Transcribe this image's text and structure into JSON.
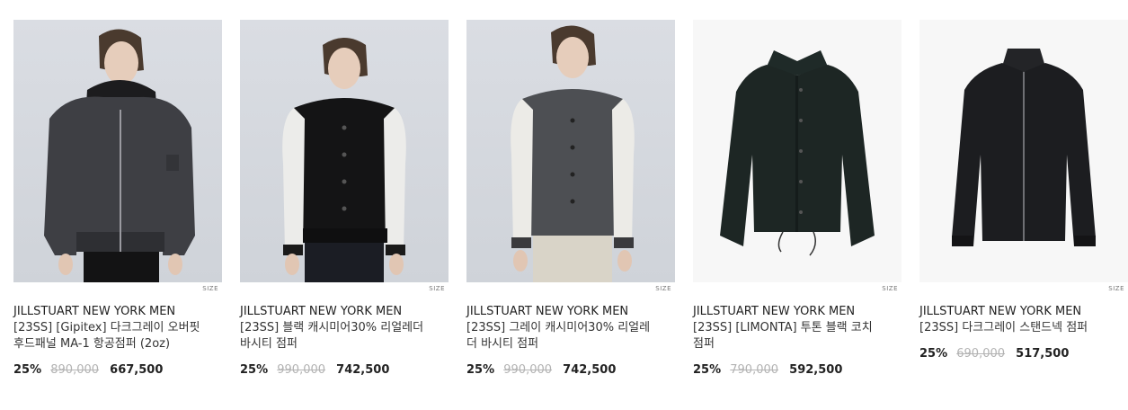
{
  "products": [
    {
      "brand": "JILLSTUART NEW YORK MEN",
      "name": "[23SS] [Gipitex] 다크그레이 오버핏 후드패널 MA-1 항공점퍼 (2oz)",
      "size_label": "SIZE",
      "discount": "25%",
      "original_price": "890,000",
      "sale_price": "667,500",
      "image": "model wearing dark grey hooded MA-1 jacket"
    },
    {
      "brand": "JILLSTUART NEW YORK MEN",
      "name": "[23SS] 블랙 캐시미어30% 리얼레더 바시티 점퍼",
      "size_label": "SIZE",
      "discount": "25%",
      "original_price": "990,000",
      "sale_price": "742,500",
      "image": "model wearing black varsity jacket with white sleeves"
    },
    {
      "brand": "JILLSTUART NEW YORK MEN",
      "name": "[23SS] 그레이 캐시미어30% 리얼레더 바시티 점퍼",
      "size_label": "SIZE",
      "discount": "25%",
      "original_price": "990,000",
      "sale_price": "742,500",
      "image": "model wearing grey varsity jacket with white sleeves"
    },
    {
      "brand": "JILLSTUART NEW YORK MEN",
      "name": "[23SS] [LIMONTA] 투톤 블랙 코치 점퍼",
      "size_label": "SIZE",
      "discount": "25%",
      "original_price": "790,000",
      "sale_price": "592,500",
      "image": "black coach jacket flat lay"
    },
    {
      "brand": "JILLSTUART NEW YORK MEN",
      "name": "[23SS] 다크그레이 스탠드넥 점퍼",
      "size_label": "SIZE",
      "discount": "25%",
      "original_price": "690,000",
      "sale_price": "517,500",
      "image": "dark grey stand-neck jacket flat lay"
    }
  ],
  "colors": {
    "text": "#222222",
    "strike": "#b3b3b3",
    "photo_bg": "#d4d7dc",
    "flat_bg": "#f7f7f7"
  }
}
